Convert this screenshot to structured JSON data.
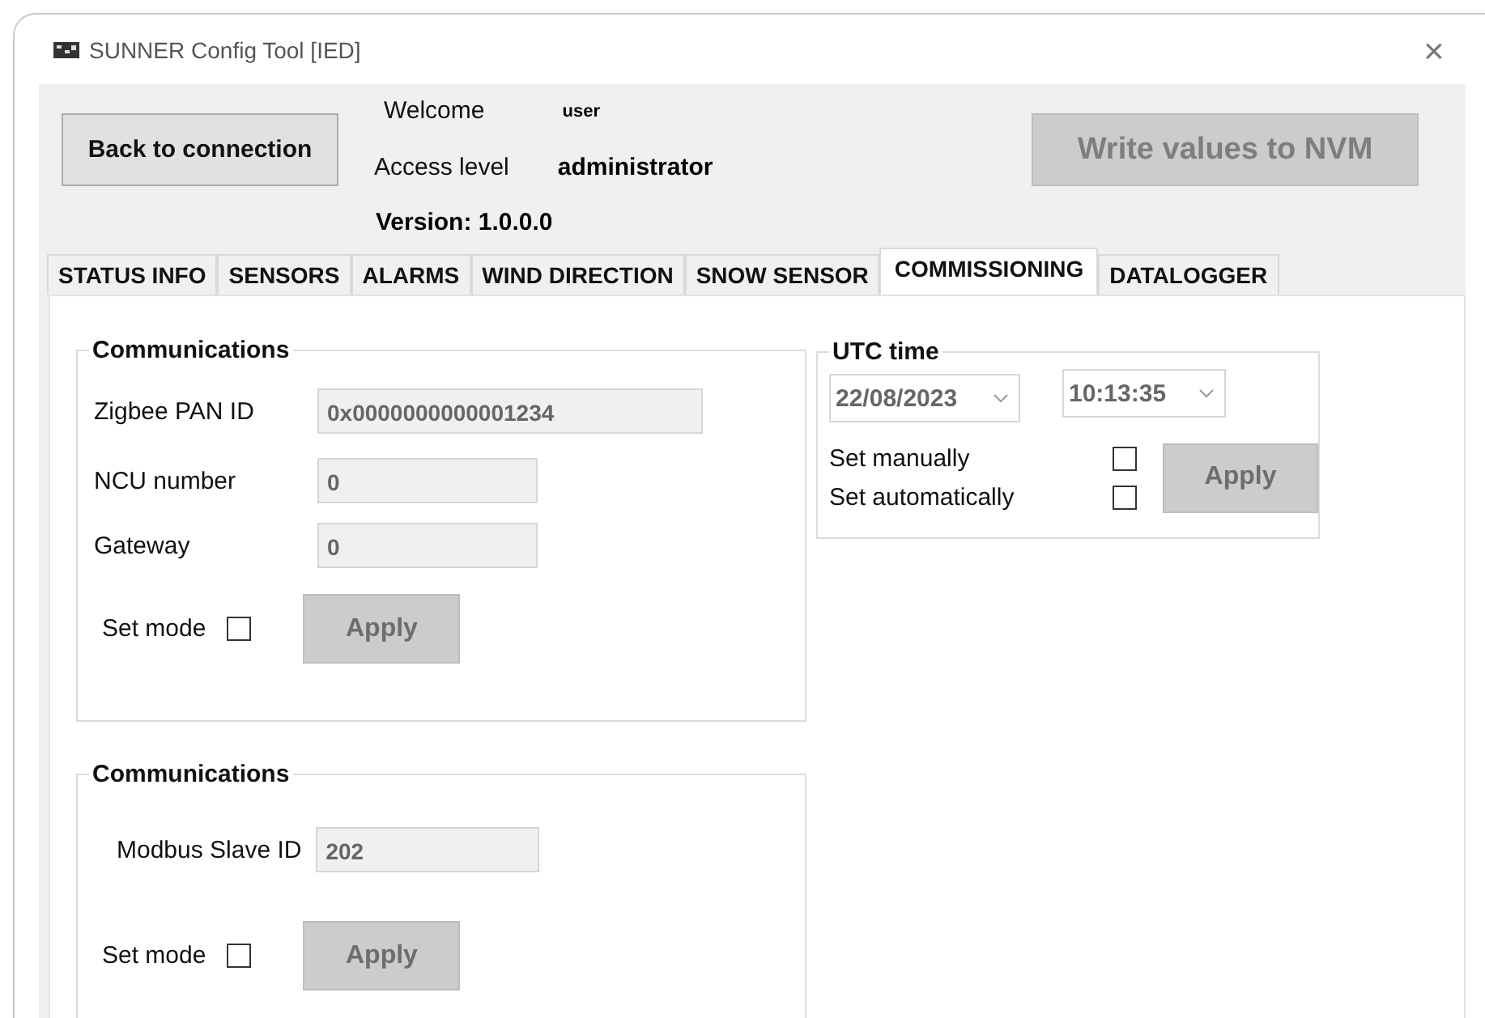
{
  "window": {
    "title": "SUNNER Config Tool [IED]",
    "close": "×"
  },
  "header": {
    "back_button": "Back to connection",
    "welcome_label": "Welcome",
    "user": "user",
    "access_label": "Access level",
    "access_level": "administrator",
    "version": "Version: 1.0.0.0",
    "write_button": {
      "label": "Write values to NVM",
      "disabled": true
    }
  },
  "tabs": [
    {
      "label": "STATUS INFO",
      "selected": false
    },
    {
      "label": "SENSORS",
      "selected": false
    },
    {
      "label": "ALARMS",
      "selected": false
    },
    {
      "label": "WIND DIRECTION",
      "selected": false
    },
    {
      "label": "SNOW SENSOR",
      "selected": false
    },
    {
      "label": "COMMISSIONING",
      "selected": true
    },
    {
      "label": "DATALOGGER",
      "selected": false
    }
  ],
  "zigbee_group": {
    "title": "Communications",
    "fields": [
      {
        "label": "Zigbee PAN ID",
        "value": "0x0000000000001234"
      },
      {
        "label": "NCU number",
        "value": "0"
      },
      {
        "label": "Gateway",
        "value": "0"
      }
    ],
    "set_mode": {
      "label": "Set mode",
      "checked": false
    },
    "apply": {
      "label": "Apply",
      "disabled": true
    }
  },
  "utc_group": {
    "title": "UTC time",
    "date": "22/08/2023",
    "time": "10:13:35",
    "options": [
      {
        "label": "Set manually",
        "checked": false
      },
      {
        "label": "Set automatically",
        "checked": false
      }
    ],
    "apply": {
      "label": "Apply",
      "disabled": true
    }
  },
  "modbus_group": {
    "title": "Communications",
    "field": {
      "label": "Modbus Slave ID",
      "value": "202"
    },
    "set_mode": {
      "label": "Set mode",
      "checked": false
    },
    "apply": {
      "label": "Apply",
      "disabled": true
    }
  }
}
